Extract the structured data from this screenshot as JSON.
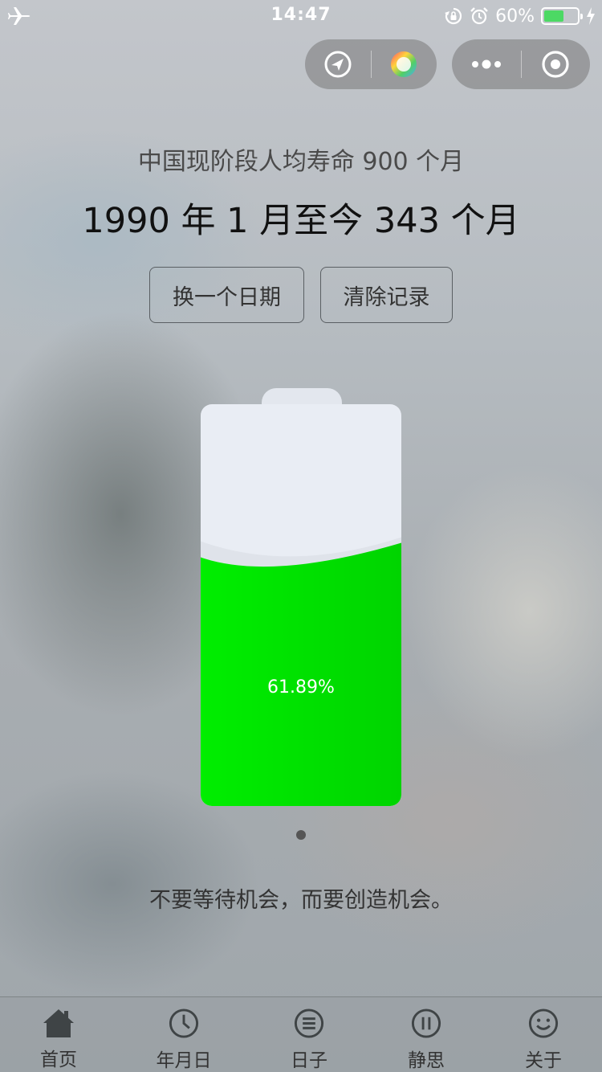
{
  "status_bar": {
    "time": "14:47",
    "battery_percent_text": "60%",
    "battery_level": 0.6,
    "icons": [
      "airplane-icon",
      "orientation-lock-icon",
      "alarm-icon",
      "battery-icon",
      "charging-icon"
    ]
  },
  "capsule": {
    "left_buttons": [
      "send-icon",
      "color-wheel-icon"
    ],
    "right_buttons": [
      "more-icon",
      "close-target-icon"
    ]
  },
  "main": {
    "lifespan_text": "中国现阶段人均寿命 900 个月",
    "months_text": "1990 年 1 月至今 343 个月",
    "change_date_label": "换一个日期",
    "clear_record_label": "清除记录",
    "battery_percent_label": "61.89%",
    "battery_fill_fraction": 0.6189,
    "battery_fill_color": "#00e600",
    "quote": "不要等待机会，而要创造机会。"
  },
  "tabs": [
    {
      "label": "首页",
      "icon": "home-icon",
      "active": true
    },
    {
      "label": "年月日",
      "icon": "clock-icon",
      "active": false
    },
    {
      "label": "日子",
      "icon": "list-icon",
      "active": false
    },
    {
      "label": "静思",
      "icon": "pause-icon",
      "active": false
    },
    {
      "label": "关于",
      "icon": "smile-icon",
      "active": false
    }
  ]
}
